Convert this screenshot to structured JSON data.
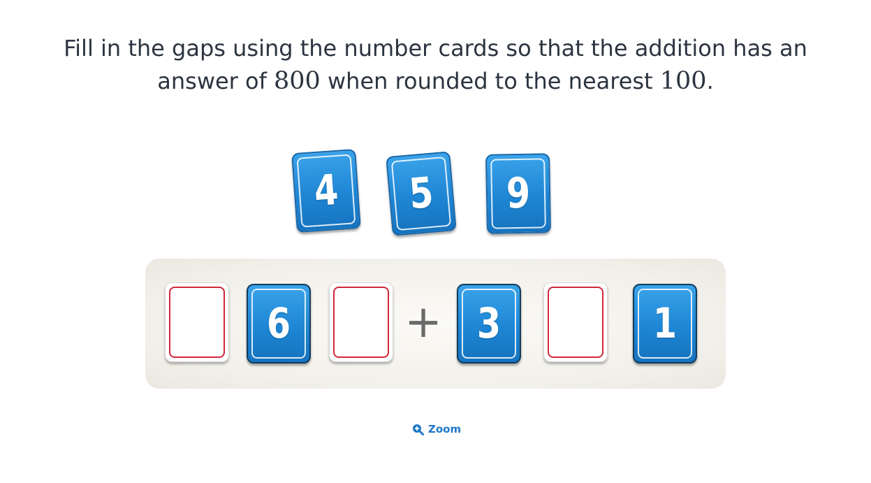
{
  "question": {
    "line1": "Fill in the gaps using the number cards so that the addition has an",
    "line2_a": "answer of ",
    "line2_num1": "800",
    "line2_b": " when rounded to the nearest ",
    "line2_num2": "100",
    "line2_c": "."
  },
  "number_cards": [
    {
      "value": "4"
    },
    {
      "value": "5"
    },
    {
      "value": "9"
    }
  ],
  "equation": {
    "first_number": [
      {
        "value": ""
      },
      {
        "value": "6"
      },
      {
        "value": ""
      }
    ],
    "operator": "+",
    "second_number": [
      {
        "value": "3"
      },
      {
        "value": ""
      },
      {
        "value": "1"
      }
    ]
  },
  "zoom": {
    "label": "Zoom",
    "icon": "zoom-in-icon"
  },
  "colors": {
    "card_blue": "#1e86d4",
    "slot_border_red": "#d0273a",
    "zoom_blue": "#1f78c8",
    "text": "#2c3440"
  }
}
